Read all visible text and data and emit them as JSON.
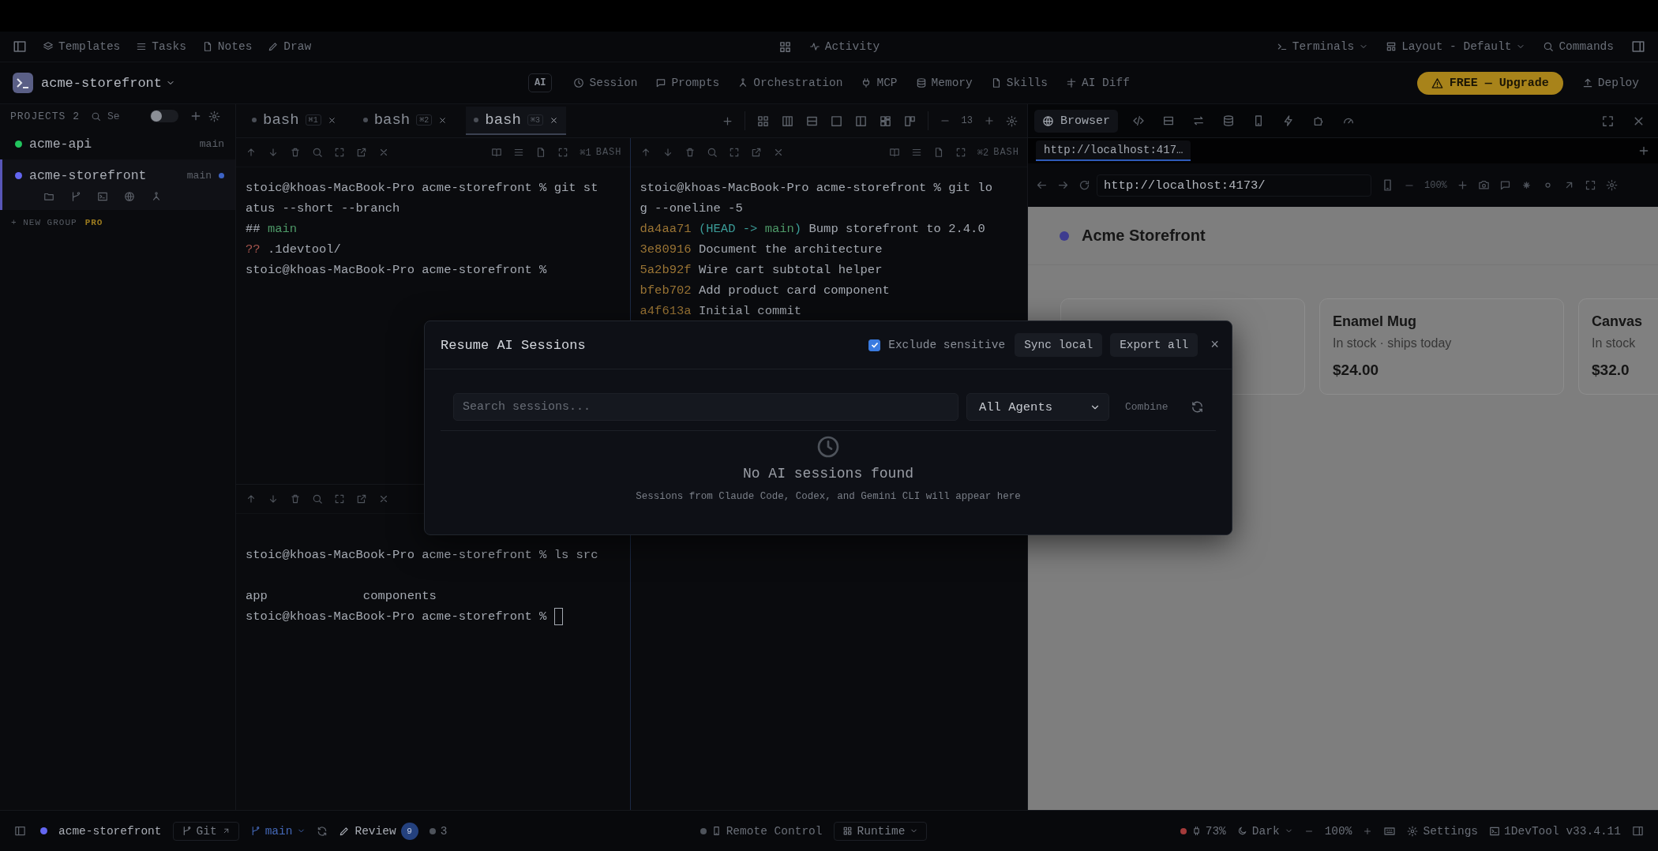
{
  "toolbar": {
    "left": [
      {
        "label": "Templates"
      },
      {
        "label": "Tasks"
      },
      {
        "label": "Notes"
      },
      {
        "label": "Draw"
      }
    ],
    "center": {
      "label": "Activity"
    },
    "right": [
      {
        "label": "Terminals"
      },
      {
        "label": "Layout - Default"
      },
      {
        "label": "Commands"
      }
    ]
  },
  "project_bar": {
    "name": "acme-storefront",
    "ai_badge": "AI",
    "tools": [
      "Session",
      "Prompts",
      "Orchestration",
      "MCP",
      "Memory",
      "Skills",
      "AI Diff"
    ],
    "upgrade": "FREE — Upgrade",
    "deploy": "Deploy"
  },
  "sidebar": {
    "title": "PROJECTS 2",
    "search": {
      "placeholder": "Se"
    },
    "toggle": {
      "on": false
    },
    "projects": [
      {
        "name": "acme-api",
        "branch": "main",
        "color": "#22c55e",
        "selected": false,
        "modified": false
      },
      {
        "name": "acme-storefront",
        "branch": "main",
        "color": "#6366f1",
        "selected": true,
        "modified": true
      }
    ],
    "new_group": "+ NEW GROUP",
    "pro_badge": "PRO"
  },
  "terminal_tabs": [
    {
      "label": "bash",
      "shortcut": "⌘1",
      "selected": false
    },
    {
      "label": "bash",
      "shortcut": "⌘2",
      "selected": false
    },
    {
      "label": "bash",
      "shortcut": "⌘3",
      "selected": true
    }
  ],
  "font_size": "13",
  "columns": [
    {
      "panes": [
        {
          "shortcut": "⌘1",
          "shell": "BASH",
          "lines": [
            {
              "spans": [
                {
                  "text": "stoic@khoas-MacBook-Pro acme-storefront % git st",
                  "kind": "plain"
                }
              ]
            },
            {
              "spans": [
                {
                  "text": "atus --short --branch",
                  "kind": "plain"
                }
              ]
            },
            {
              "spans": [
                {
                  "text": "## ",
                  "kind": "plain"
                },
                {
                  "text": "main",
                  "kind": "green"
                }
              ]
            },
            {
              "spans": [
                {
                  "text": "??",
                  "kind": "warn"
                },
                {
                  "text": " .1devtool/",
                  "kind": "plain"
                }
              ]
            },
            {
              "spans": [
                {
                  "text": "stoic@khoas-MacBook-Pro acme-storefront %",
                  "kind": "plain"
                }
              ]
            }
          ]
        },
        {
          "cursor": true,
          "lines": [
            {
              "spaced": true,
              "spans": [
                {
                  "text": "stoic@khoas-MacBook-Pro acme-storefront % ls src",
                  "kind": "plain"
                }
              ]
            },
            {
              "spaced": true,
              "spans": [
                {
                  "text": "app             components",
                  "kind": "plain"
                }
              ]
            },
            {
              "spans": [
                {
                  "text": "stoic@khoas-MacBook-Pro acme-storefront %",
                  "kind": "plain"
                }
              ]
            }
          ]
        }
      ]
    },
    {
      "panes": [
        {
          "shortcut": "⌘2",
          "shell": "BASH",
          "lines": [
            {
              "spans": [
                {
                  "text": "stoic@khoas-MacBook-Pro acme-storefront % git lo",
                  "kind": "plain"
                }
              ]
            },
            {
              "spans": [
                {
                  "text": "g --oneline -5",
                  "kind": "plain"
                }
              ]
            },
            {
              "spans": [
                {
                  "text": "da4aa71",
                  "kind": "hash"
                },
                {
                  "text": " (HEAD -> ",
                  "kind": "ref"
                },
                {
                  "text": "main",
                  "kind": "green"
                },
                {
                  "text": ")",
                  "kind": "ref"
                },
                {
                  "text": " Bump storefront to 2.4.0",
                  "kind": "plain"
                }
              ]
            },
            {
              "spans": [
                {
                  "text": "3e80916",
                  "kind": "hash"
                },
                {
                  "text": " Document the architecture",
                  "kind": "plain"
                }
              ]
            },
            {
              "spans": [
                {
                  "text": "5a2b92f",
                  "kind": "hash"
                },
                {
                  "text": " Wire cart subtotal helper",
                  "kind": "plain"
                }
              ]
            },
            {
              "spans": [
                {
                  "text": "bfeb702",
                  "kind": "hash"
                },
                {
                  "text": " Add product card component",
                  "kind": "plain"
                }
              ]
            },
            {
              "spans": [
                {
                  "text": "a4f613a",
                  "kind": "hash"
                },
                {
                  "text": " Initial commit",
                  "kind": "plain"
                }
              ]
            }
          ]
        }
      ]
    }
  ],
  "browser": {
    "tab_label": "Browser",
    "page_tabs": [
      {
        "label": "http://localhost:417…",
        "selected": true
      }
    ],
    "url": "http://localhost:4173/",
    "zoom": "100%",
    "site_title": "Acme Storefront",
    "products": [
      {
        "name": "Enamel Mug",
        "stock": "In stock · ships today",
        "price": "$24.00"
      },
      {
        "name": "Canvas",
        "stock": "In stock",
        "price": "$32.0"
      }
    ]
  },
  "modal": {
    "title": "Resume AI Sessions",
    "exclude_sensitive": {
      "label": "Exclude sensitive",
      "checked": true
    },
    "buttons": [
      "Sync local",
      "Export all"
    ],
    "close": "×",
    "search": {
      "placeholder": "Search sessions..."
    },
    "agent_select": "All Agents",
    "combine": "Combine",
    "empty": {
      "title": "No AI sessions found",
      "hint": "Sessions from Claude Code, Codex, and Gemini CLI will appear here"
    }
  },
  "status_bar": {
    "project": {
      "name": "acme-storefront",
      "color": "#6366f1"
    },
    "git": "Git",
    "branch": "main",
    "review": {
      "label": "Review",
      "count": "9"
    },
    "changes": "3",
    "remote": "Remote Control",
    "runtime": "Runtime",
    "memory": "73%",
    "theme": "Dark",
    "zoom": "100%",
    "settings": "Settings",
    "version": "1DevTool v33.4.11"
  }
}
